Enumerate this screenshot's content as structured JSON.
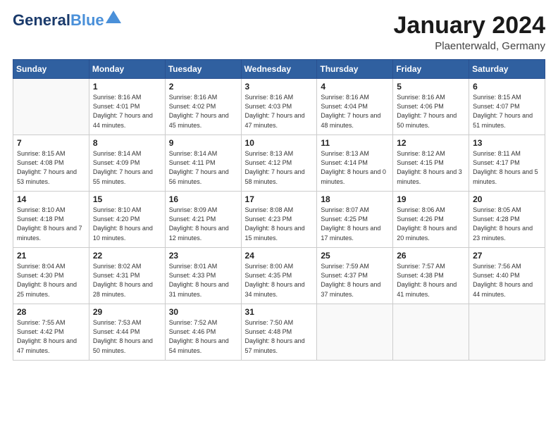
{
  "header": {
    "logo_general": "General",
    "logo_blue": "Blue",
    "month": "January 2024",
    "location": "Plaenterwald, Germany"
  },
  "weekdays": [
    "Sunday",
    "Monday",
    "Tuesday",
    "Wednesday",
    "Thursday",
    "Friday",
    "Saturday"
  ],
  "weeks": [
    [
      {
        "day": "",
        "sunrise": "",
        "sunset": "",
        "daylight": ""
      },
      {
        "day": "1",
        "sunrise": "Sunrise: 8:16 AM",
        "sunset": "Sunset: 4:01 PM",
        "daylight": "Daylight: 7 hours and 44 minutes."
      },
      {
        "day": "2",
        "sunrise": "Sunrise: 8:16 AM",
        "sunset": "Sunset: 4:02 PM",
        "daylight": "Daylight: 7 hours and 45 minutes."
      },
      {
        "day": "3",
        "sunrise": "Sunrise: 8:16 AM",
        "sunset": "Sunset: 4:03 PM",
        "daylight": "Daylight: 7 hours and 47 minutes."
      },
      {
        "day": "4",
        "sunrise": "Sunrise: 8:16 AM",
        "sunset": "Sunset: 4:04 PM",
        "daylight": "Daylight: 7 hours and 48 minutes."
      },
      {
        "day": "5",
        "sunrise": "Sunrise: 8:16 AM",
        "sunset": "Sunset: 4:06 PM",
        "daylight": "Daylight: 7 hours and 50 minutes."
      },
      {
        "day": "6",
        "sunrise": "Sunrise: 8:15 AM",
        "sunset": "Sunset: 4:07 PM",
        "daylight": "Daylight: 7 hours and 51 minutes."
      }
    ],
    [
      {
        "day": "7",
        "sunrise": "Sunrise: 8:15 AM",
        "sunset": "Sunset: 4:08 PM",
        "daylight": "Daylight: 7 hours and 53 minutes."
      },
      {
        "day": "8",
        "sunrise": "Sunrise: 8:14 AM",
        "sunset": "Sunset: 4:09 PM",
        "daylight": "Daylight: 7 hours and 55 minutes."
      },
      {
        "day": "9",
        "sunrise": "Sunrise: 8:14 AM",
        "sunset": "Sunset: 4:11 PM",
        "daylight": "Daylight: 7 hours and 56 minutes."
      },
      {
        "day": "10",
        "sunrise": "Sunrise: 8:13 AM",
        "sunset": "Sunset: 4:12 PM",
        "daylight": "Daylight: 7 hours and 58 minutes."
      },
      {
        "day": "11",
        "sunrise": "Sunrise: 8:13 AM",
        "sunset": "Sunset: 4:14 PM",
        "daylight": "Daylight: 8 hours and 0 minutes."
      },
      {
        "day": "12",
        "sunrise": "Sunrise: 8:12 AM",
        "sunset": "Sunset: 4:15 PM",
        "daylight": "Daylight: 8 hours and 3 minutes."
      },
      {
        "day": "13",
        "sunrise": "Sunrise: 8:11 AM",
        "sunset": "Sunset: 4:17 PM",
        "daylight": "Daylight: 8 hours and 5 minutes."
      }
    ],
    [
      {
        "day": "14",
        "sunrise": "Sunrise: 8:10 AM",
        "sunset": "Sunset: 4:18 PM",
        "daylight": "Daylight: 8 hours and 7 minutes."
      },
      {
        "day": "15",
        "sunrise": "Sunrise: 8:10 AM",
        "sunset": "Sunset: 4:20 PM",
        "daylight": "Daylight: 8 hours and 10 minutes."
      },
      {
        "day": "16",
        "sunrise": "Sunrise: 8:09 AM",
        "sunset": "Sunset: 4:21 PM",
        "daylight": "Daylight: 8 hours and 12 minutes."
      },
      {
        "day": "17",
        "sunrise": "Sunrise: 8:08 AM",
        "sunset": "Sunset: 4:23 PM",
        "daylight": "Daylight: 8 hours and 15 minutes."
      },
      {
        "day": "18",
        "sunrise": "Sunrise: 8:07 AM",
        "sunset": "Sunset: 4:25 PM",
        "daylight": "Daylight: 8 hours and 17 minutes."
      },
      {
        "day": "19",
        "sunrise": "Sunrise: 8:06 AM",
        "sunset": "Sunset: 4:26 PM",
        "daylight": "Daylight: 8 hours and 20 minutes."
      },
      {
        "day": "20",
        "sunrise": "Sunrise: 8:05 AM",
        "sunset": "Sunset: 4:28 PM",
        "daylight": "Daylight: 8 hours and 23 minutes."
      }
    ],
    [
      {
        "day": "21",
        "sunrise": "Sunrise: 8:04 AM",
        "sunset": "Sunset: 4:30 PM",
        "daylight": "Daylight: 8 hours and 25 minutes."
      },
      {
        "day": "22",
        "sunrise": "Sunrise: 8:02 AM",
        "sunset": "Sunset: 4:31 PM",
        "daylight": "Daylight: 8 hours and 28 minutes."
      },
      {
        "day": "23",
        "sunrise": "Sunrise: 8:01 AM",
        "sunset": "Sunset: 4:33 PM",
        "daylight": "Daylight: 8 hours and 31 minutes."
      },
      {
        "day": "24",
        "sunrise": "Sunrise: 8:00 AM",
        "sunset": "Sunset: 4:35 PM",
        "daylight": "Daylight: 8 hours and 34 minutes."
      },
      {
        "day": "25",
        "sunrise": "Sunrise: 7:59 AM",
        "sunset": "Sunset: 4:37 PM",
        "daylight": "Daylight: 8 hours and 37 minutes."
      },
      {
        "day": "26",
        "sunrise": "Sunrise: 7:57 AM",
        "sunset": "Sunset: 4:38 PM",
        "daylight": "Daylight: 8 hours and 41 minutes."
      },
      {
        "day": "27",
        "sunrise": "Sunrise: 7:56 AM",
        "sunset": "Sunset: 4:40 PM",
        "daylight": "Daylight: 8 hours and 44 minutes."
      }
    ],
    [
      {
        "day": "28",
        "sunrise": "Sunrise: 7:55 AM",
        "sunset": "Sunset: 4:42 PM",
        "daylight": "Daylight: 8 hours and 47 minutes."
      },
      {
        "day": "29",
        "sunrise": "Sunrise: 7:53 AM",
        "sunset": "Sunset: 4:44 PM",
        "daylight": "Daylight: 8 hours and 50 minutes."
      },
      {
        "day": "30",
        "sunrise": "Sunrise: 7:52 AM",
        "sunset": "Sunset: 4:46 PM",
        "daylight": "Daylight: 8 hours and 54 minutes."
      },
      {
        "day": "31",
        "sunrise": "Sunrise: 7:50 AM",
        "sunset": "Sunset: 4:48 PM",
        "daylight": "Daylight: 8 hours and 57 minutes."
      },
      {
        "day": "",
        "sunrise": "",
        "sunset": "",
        "daylight": ""
      },
      {
        "day": "",
        "sunrise": "",
        "sunset": "",
        "daylight": ""
      },
      {
        "day": "",
        "sunrise": "",
        "sunset": "",
        "daylight": ""
      }
    ]
  ]
}
